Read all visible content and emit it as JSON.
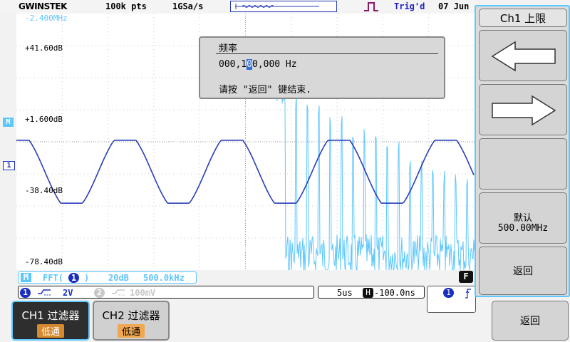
{
  "topbar": {
    "brand": "GWINSTEK",
    "memory_length": "100k pts",
    "sample_rate": "1GSa/s",
    "trigger_state": "Trig'd",
    "date": "07 Jun"
  },
  "screen": {
    "fft_top_freq": "-2.400MHz",
    "db_labels": [
      "+41.60dB",
      "+1.600dB",
      "-38.40dB",
      "-78.40dB"
    ],
    "markers": {
      "math": "M",
      "ch1": "1"
    }
  },
  "dialog": {
    "title": "频率",
    "value_prefix": "000,1",
    "value_cursor": "0",
    "value_suffix": "0,000 Hz",
    "hint": "请按 \"返回\" 键结束."
  },
  "fft_bar": {
    "badge": "M",
    "label": "FFT(",
    "source": "1",
    "close": ")",
    "scale": "20dB",
    "span": "500.0kHz"
  },
  "channel_info": {
    "ch1_num": "1",
    "ch1_coupling_icon": "dc-coupling-icon",
    "ch1_scale": "2V",
    "ch2_num": "2",
    "ch2_coupling_icon": "dc-coupling-icon",
    "ch2_scale": "100mV"
  },
  "timebase": {
    "scale": "5us",
    "h_badge": "H",
    "position": "-100.0ns"
  },
  "trigger_box": {
    "source": "1"
  },
  "f_badge": "F",
  "softkeys": {
    "ch1_filter": {
      "title": "CH1 过滤器",
      "value": "低通"
    },
    "ch2_filter": {
      "title": "CH2 过滤器",
      "value": "低通"
    },
    "back": "返回"
  },
  "right_menu": {
    "title": "Ch1 上限",
    "left_icon": "arrow-left-icon",
    "right_icon": "arrow-right-icon",
    "default_label": "默认",
    "default_value": "500.00MHz",
    "back_label": "返回"
  },
  "colors": {
    "ch1_trace": "#2a3fb8",
    "fft_trace": "#5ec7ff",
    "accent": "#5ec7ff",
    "softkey_value": "#d68a2e"
  }
}
